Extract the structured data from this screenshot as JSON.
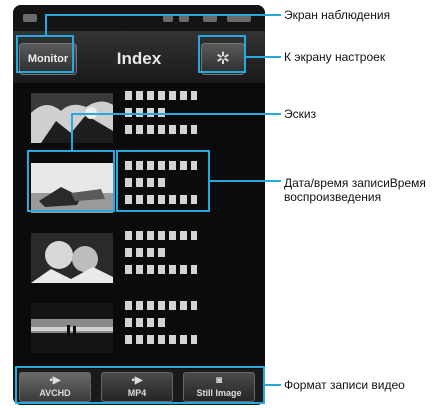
{
  "header": {
    "monitor_label": "Monitor",
    "title": "Index",
    "settings_icon": "gear-icon"
  },
  "footer": {
    "tabs": [
      {
        "label": "AVCHD",
        "icon": "video-camera-icon",
        "active": true
      },
      {
        "label": "MP4",
        "icon": "video-camera-icon",
        "active": false
      },
      {
        "label": "Still Image",
        "icon": "camera-icon",
        "active": false
      }
    ]
  },
  "callouts": {
    "monitor": "Экран наблюдения",
    "settings": "К экрану настроек",
    "thumbnail": "Эскиз",
    "datetime_line1": "Дата/время записиВремя",
    "datetime_line2": "воспроизведения",
    "format": "Формат записи видео"
  },
  "colors": {
    "accent": "#26a8e0",
    "screen_bg": "#0b0b0b"
  }
}
